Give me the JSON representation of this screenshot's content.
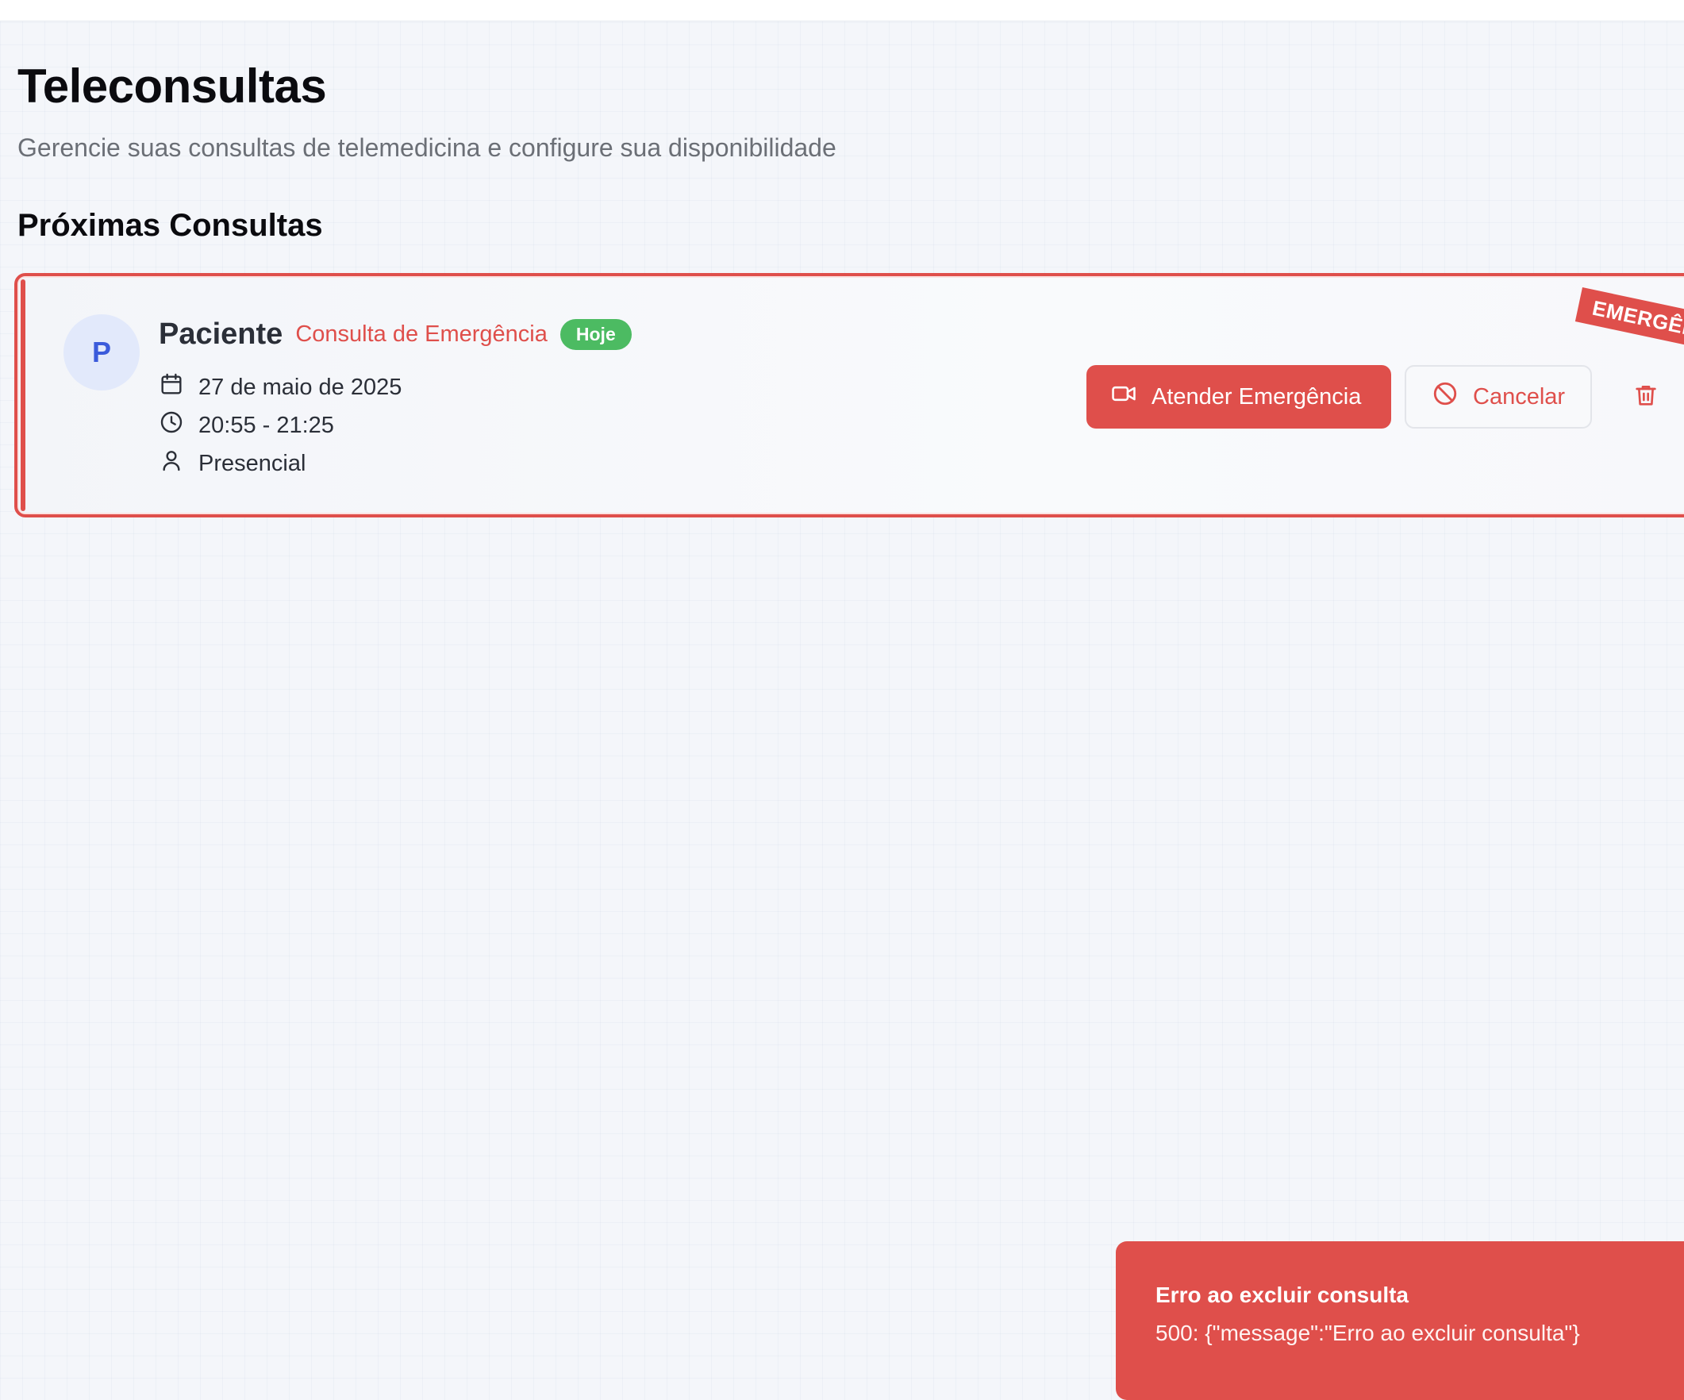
{
  "header": {
    "title": "Teleconsultas",
    "subtitle": "Gerencie suas consultas de telemedicina e configure sua disponibilidade"
  },
  "section": {
    "title": "Próximas Consultas"
  },
  "appointment": {
    "avatar_initial": "P",
    "patient_name": "Paciente",
    "type": "Consulta de Emergência",
    "badge": "Hoje",
    "date": "27 de maio de 2025",
    "time": "20:55 - 21:25",
    "mode": "Presencial",
    "ribbon": "EMERGÊN",
    "icons": {
      "date": "calendar-icon",
      "time": "clock-icon",
      "mode": "person-icon",
      "primary_action": "video-camera-icon",
      "cancel_action": "ban-icon",
      "delete_action": "trash-icon"
    },
    "actions": {
      "primary_label": "Atender Emergência",
      "cancel_label": "Cancelar"
    }
  },
  "toast": {
    "title": "Erro ao excluir consulta",
    "message": "500: {\"message\":\"Erro ao excluir consulta\"}"
  },
  "colors": {
    "danger": "#df4f4b",
    "success": "#4cbb62",
    "avatar_bg": "#e2e9fb",
    "avatar_text": "#3b5bdb"
  }
}
